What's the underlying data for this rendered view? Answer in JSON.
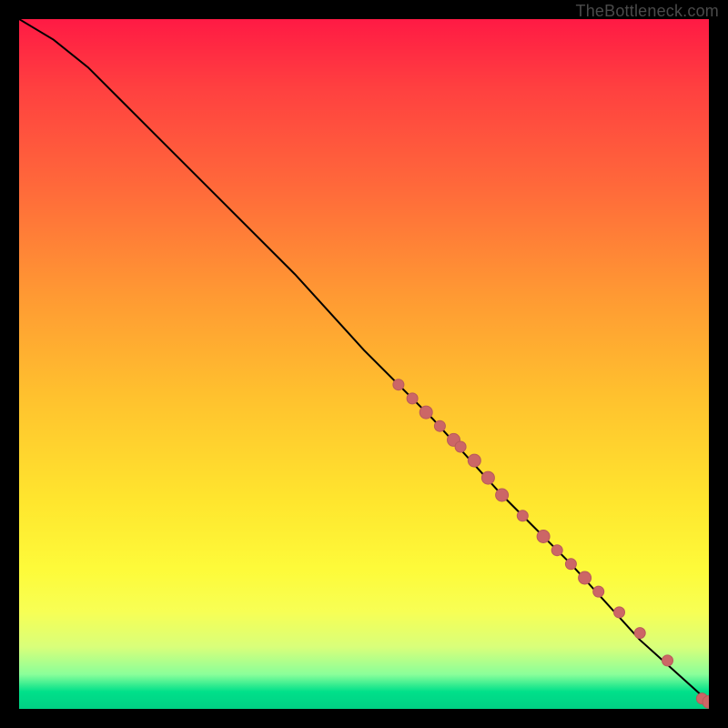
{
  "attribution": "TheBottleneck.com",
  "colors": {
    "curve": "#000000",
    "point_fill": "#cc6666",
    "point_stroke": "#b85a5a"
  },
  "chart_data": {
    "type": "line",
    "title": "",
    "xlabel": "",
    "ylabel": "",
    "xlim": [
      0,
      100
    ],
    "ylim": [
      0,
      100
    ],
    "curve": {
      "x": [
        0,
        5,
        10,
        15,
        20,
        30,
        40,
        50,
        60,
        70,
        80,
        90,
        100
      ],
      "y": [
        100,
        97,
        93,
        88,
        83,
        73,
        63,
        52,
        42,
        31,
        21,
        10,
        1
      ]
    },
    "points": {
      "x": [
        55,
        57,
        59,
        61,
        63,
        64,
        66,
        68,
        70,
        73,
        76,
        78,
        80,
        82,
        84,
        87,
        90,
        94,
        99,
        100
      ],
      "y": [
        47,
        45,
        43,
        41,
        39,
        38,
        36,
        33.5,
        31,
        28,
        25,
        23,
        21,
        19,
        17,
        14,
        11,
        7,
        1.5,
        1
      ],
      "r": [
        6,
        6,
        7,
        6,
        7,
        6,
        7,
        7,
        7,
        6,
        7,
        6,
        6,
        7,
        6,
        6,
        6,
        6,
        6,
        7
      ]
    }
  }
}
